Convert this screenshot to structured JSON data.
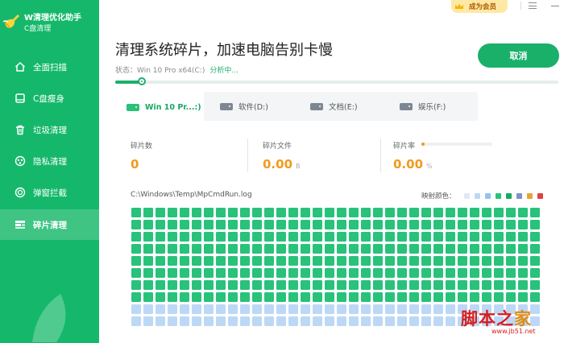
{
  "app": {
    "title": "W清理优化助手",
    "subtitle": "C盘清理"
  },
  "sidebar": {
    "items": [
      {
        "label": "全面扫描",
        "icon": "home-icon",
        "active": false
      },
      {
        "label": "C盘瘦身",
        "icon": "drive-icon",
        "active": false
      },
      {
        "label": "垃圾清理",
        "icon": "trash-icon",
        "active": false
      },
      {
        "label": "隐私清理",
        "icon": "privacy-icon",
        "active": false
      },
      {
        "label": "弹窗拦截",
        "icon": "popup-block-icon",
        "active": false
      },
      {
        "label": "碎片清理",
        "icon": "defrag-icon",
        "active": true
      }
    ]
  },
  "topbar": {
    "vip_label": "成为会员"
  },
  "header": {
    "title": "清理系统碎片，加速电脑告别卡慢",
    "status_prefix": "状态：Win 10 Pro x64(C:)",
    "status_progress": "分析中...",
    "cancel_label": "取消",
    "progress": 0.06
  },
  "tabs": [
    {
      "label": "Win 10 Pr...:)",
      "active": true
    },
    {
      "label": "软件(D:)",
      "active": false
    },
    {
      "label": "文档(E:)",
      "active": false
    },
    {
      "label": "娱乐(F:)",
      "active": false
    }
  ],
  "stats": {
    "fragments": {
      "label": "碎片数",
      "value": "0"
    },
    "fragment_files": {
      "label": "碎片文件",
      "value": "0.00",
      "unit": "B"
    },
    "fragment_rate": {
      "label": "碎片率",
      "value": "0.00",
      "unit": "%",
      "fraction": 0.0
    }
  },
  "scan": {
    "current_path": "C:\\Windows\\Temp\\MpCmdRun.log",
    "legend_label": "映射颜色：",
    "legend_colors": [
      "#dfe9f6",
      "#bcd8f6",
      "#8fc4f2",
      "#28c27a",
      "#1aa867",
      "#7b93c8",
      "#e8a338",
      "#e04040"
    ]
  },
  "map": {
    "columns": 34,
    "rows": 10,
    "used_count": 272,
    "used_color": "#28c27a",
    "free_color": "#bcd8f6"
  },
  "watermark": {
    "main_a": "脚本之",
    "main_b": "家",
    "sub": "www.jb51.net"
  },
  "colors": {
    "sidebar": "#15b86a",
    "accent": "#1bb06a",
    "value": "#f29a1d"
  }
}
